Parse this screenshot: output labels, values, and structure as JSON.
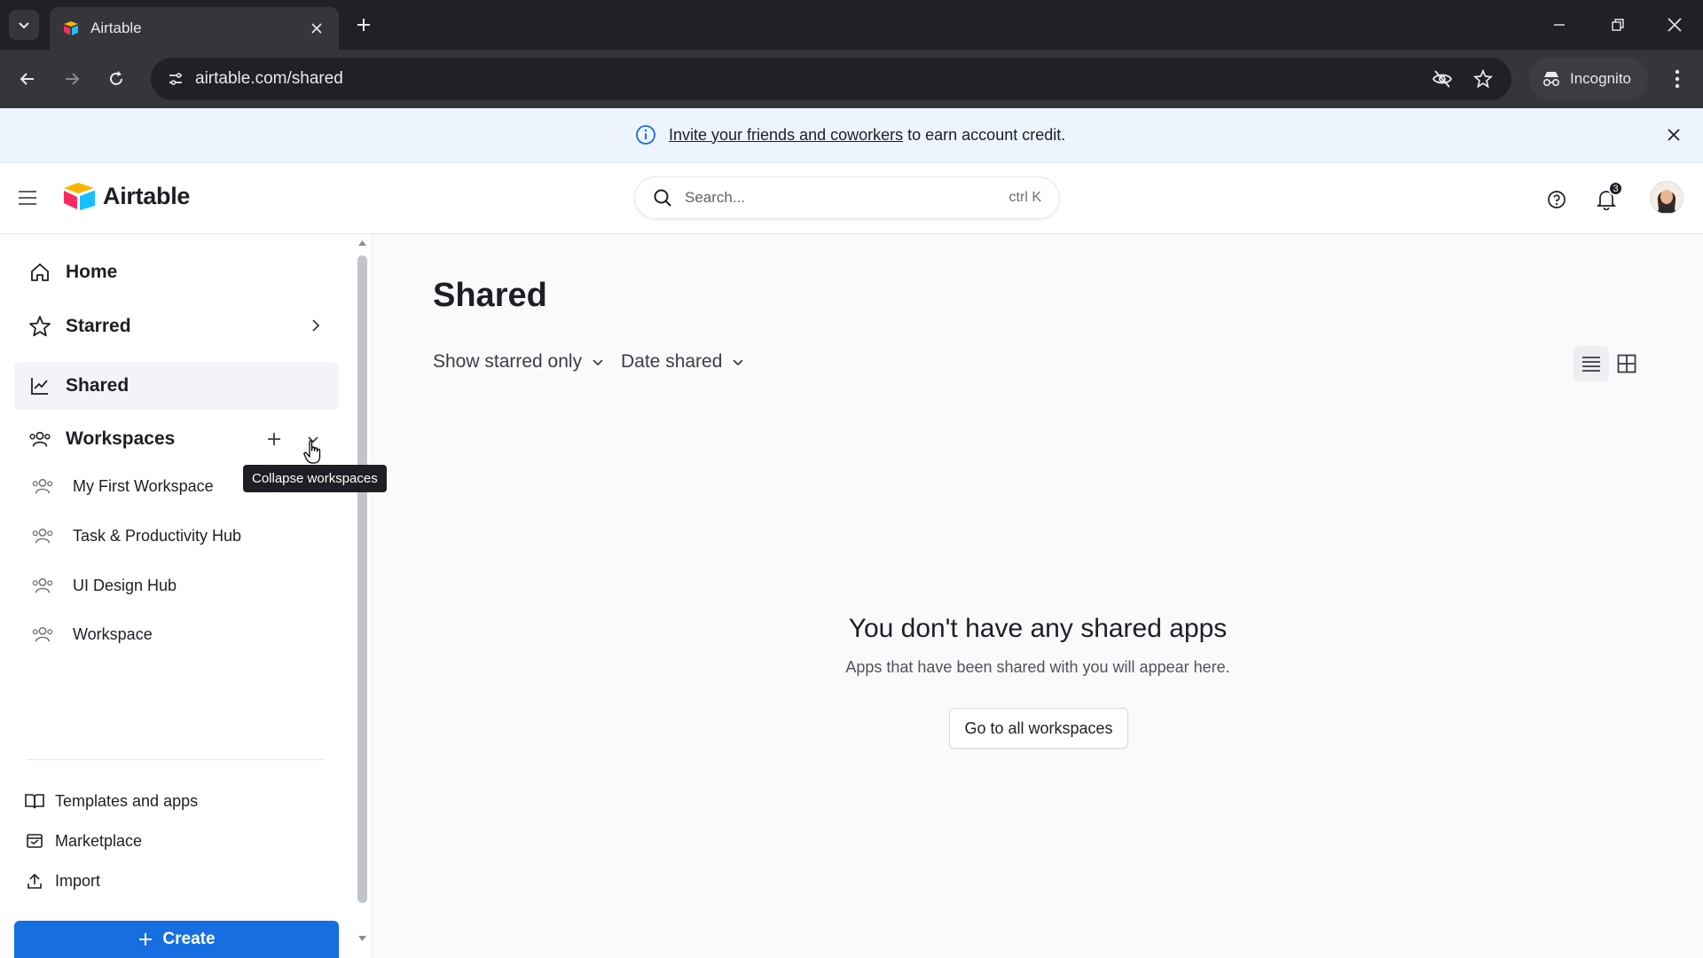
{
  "browser": {
    "tab_title": "Airtable",
    "url": "airtable.com/shared",
    "incognito_label": "Incognito"
  },
  "banner": {
    "link_text": "Invite your friends and coworkers",
    "rest_text": " to earn account credit."
  },
  "header": {
    "logo_text": "Airtable",
    "search_placeholder": "Search...",
    "search_shortcut": "ctrl K",
    "notification_count": "3"
  },
  "sidebar": {
    "nav": {
      "home": "Home",
      "starred": "Starred",
      "shared": "Shared",
      "workspaces": "Workspaces"
    },
    "workspaces": [
      {
        "label": "My First Workspace"
      },
      {
        "label": "Task & Productivity Hub"
      },
      {
        "label": "UI Design Hub"
      },
      {
        "label": "Workspace"
      }
    ],
    "tooltip": "Collapse workspaces",
    "utilities": {
      "templates": "Templates and apps",
      "marketplace": "Marketplace",
      "import": "Import"
    },
    "create_label": "Create"
  },
  "main": {
    "title": "Shared",
    "filters": {
      "starred": "Show starred only",
      "sort": "Date shared"
    },
    "empty": {
      "title": "You don't have any shared apps",
      "subtitle": "Apps that have been shared with you will appear here.",
      "button": "Go to all workspaces"
    }
  },
  "colors": {
    "accent": "#166ee1",
    "banner_bg": "#eef4fd",
    "chrome_dark": "#202124",
    "chrome_toolbar": "#35363a"
  }
}
